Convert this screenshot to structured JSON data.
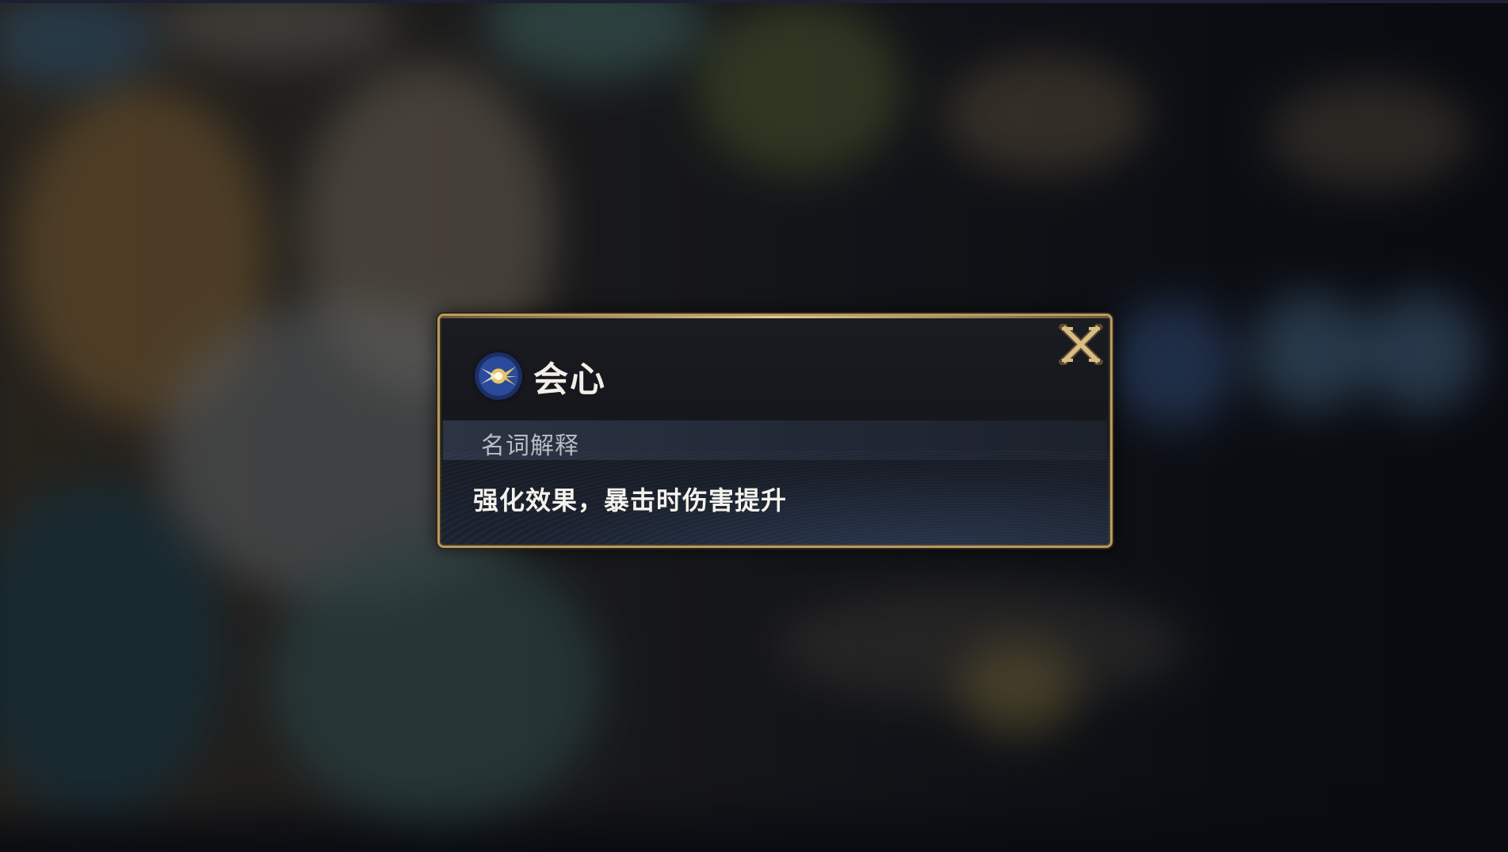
{
  "dialog": {
    "title": "会心",
    "icon": "crit-stat-icon",
    "section_label": "名词解释",
    "description": "强化效果，暴击时伤害提升",
    "close_label": "X"
  },
  "colors": {
    "frame_gold": "#b99a62",
    "title_text": "#f2efe8",
    "section_text": "#b9bcc4",
    "close_gold": "#c9ad73"
  }
}
